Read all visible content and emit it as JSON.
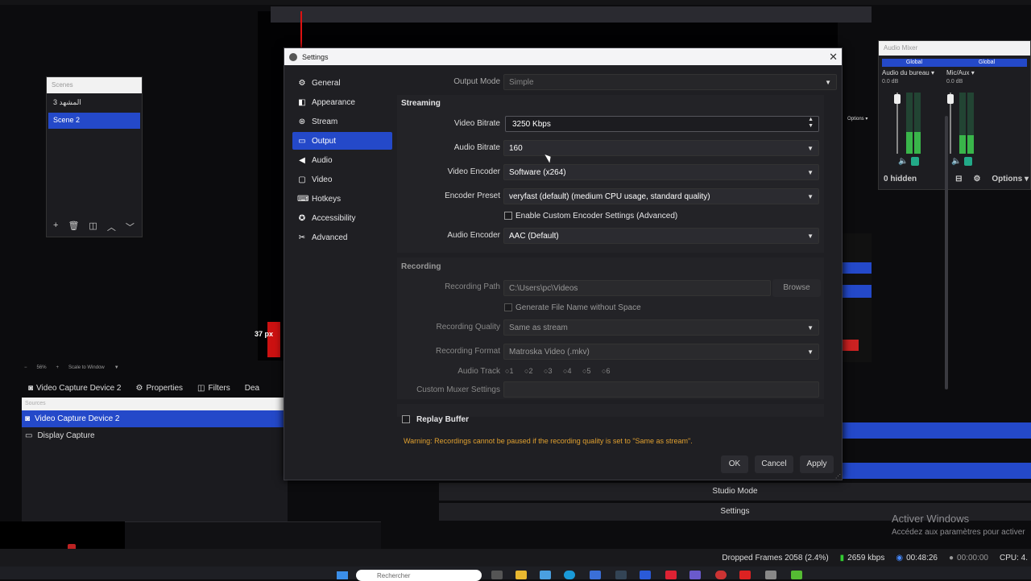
{
  "background": {
    "scenes": {
      "header": "Scenes",
      "items": [
        "المشهد 3",
        "Scene 2"
      ],
      "active_index": 1
    },
    "zoom": {
      "level": "56%",
      "scale_mode": "Scale to Window"
    },
    "source_toolbar": {
      "current": "Video Capture Device 2",
      "properties": "Properties",
      "filters": "Filters",
      "deactivate": "Dea"
    },
    "sources": {
      "header": "Sources",
      "items": [
        "Video Capture Device 2",
        "Display Capture"
      ]
    },
    "px_label": "37 px",
    "mixer": {
      "title": "Audio Mixer",
      "channels": [
        {
          "header": "Global",
          "name": "Audio du bureau",
          "db": "0.0 dB",
          "level": 0.35
        },
        {
          "header": "Global",
          "name": "Mic/Aux",
          "db": "0.0 dB",
          "level": 0.3
        }
      ],
      "hidden": "0 hidden",
      "options": "Options",
      "options_small": "Options"
    },
    "controls": {
      "studio_mode": "Studio Mode",
      "settings": "Settings"
    },
    "activate_windows": {
      "title": "Activer Windows",
      "subtitle": "Accédez aux paramètres pour activer"
    },
    "status": {
      "dropped_frames": "Dropped Frames 2058 (2.4%)",
      "bitrate": "2659 kbps",
      "stream_time": "00:48:26",
      "rec_time": "00:00:00",
      "cpu": "CPU: 4."
    },
    "taskbar": {
      "search_placeholder": "Rechercher"
    }
  },
  "dialog": {
    "title": "Settings",
    "nav": [
      {
        "label": "General",
        "icon": "gear-icon",
        "glyph": "⚙"
      },
      {
        "label": "Appearance",
        "icon": "palette-icon",
        "glyph": "◧"
      },
      {
        "label": "Stream",
        "icon": "antenna-icon",
        "glyph": "⊛"
      },
      {
        "label": "Output",
        "icon": "output-icon",
        "glyph": "▭"
      },
      {
        "label": "Audio",
        "icon": "speaker-icon",
        "glyph": "◀"
      },
      {
        "label": "Video",
        "icon": "monitor-icon",
        "glyph": "▢"
      },
      {
        "label": "Hotkeys",
        "icon": "keyboard-icon",
        "glyph": "⌨"
      },
      {
        "label": "Accessibility",
        "icon": "accessibility-icon",
        "glyph": "✪"
      },
      {
        "label": "Advanced",
        "icon": "wrench-icon",
        "glyph": "✂"
      }
    ],
    "active_nav": 3,
    "output_mode": {
      "label": "Output Mode",
      "value": "Simple"
    },
    "streaming": {
      "title": "Streaming",
      "video_bitrate": {
        "label": "Video Bitrate",
        "value": "3250 Kbps"
      },
      "audio_bitrate": {
        "label": "Audio Bitrate",
        "value": "160"
      },
      "video_encoder": {
        "label": "Video Encoder",
        "value": "Software (x264)"
      },
      "encoder_preset": {
        "label": "Encoder Preset",
        "value": "veryfast (default) (medium CPU usage, standard quality)"
      },
      "custom_encoder": {
        "label": "Enable Custom Encoder Settings (Advanced)",
        "checked": false
      },
      "audio_encoder": {
        "label": "Audio Encoder",
        "value": "AAC (Default)"
      }
    },
    "recording": {
      "title": "Recording",
      "path": {
        "label": "Recording Path",
        "value": "C:\\Users\\pc\\Videos",
        "browse": "Browse"
      },
      "no_space": {
        "label": "Generate File Name without Space",
        "checked": false
      },
      "quality": {
        "label": "Recording Quality",
        "value": "Same as stream"
      },
      "format": {
        "label": "Recording Format",
        "value": "Matroska Video (.mkv)"
      },
      "audio_track": {
        "label": "Audio Track",
        "tracks": [
          "1",
          "2",
          "3",
          "4",
          "5",
          "6"
        ],
        "selected": 0
      },
      "muxer": {
        "label": "Custom Muxer Settings",
        "value": ""
      }
    },
    "replay_buffer": {
      "label": "Replay Buffer",
      "checked": false
    },
    "warning": "Warning: Recordings cannot be paused if the recording quality is set to \"Same as stream\".",
    "buttons": {
      "ok": "OK",
      "cancel": "Cancel",
      "apply": "Apply"
    }
  }
}
